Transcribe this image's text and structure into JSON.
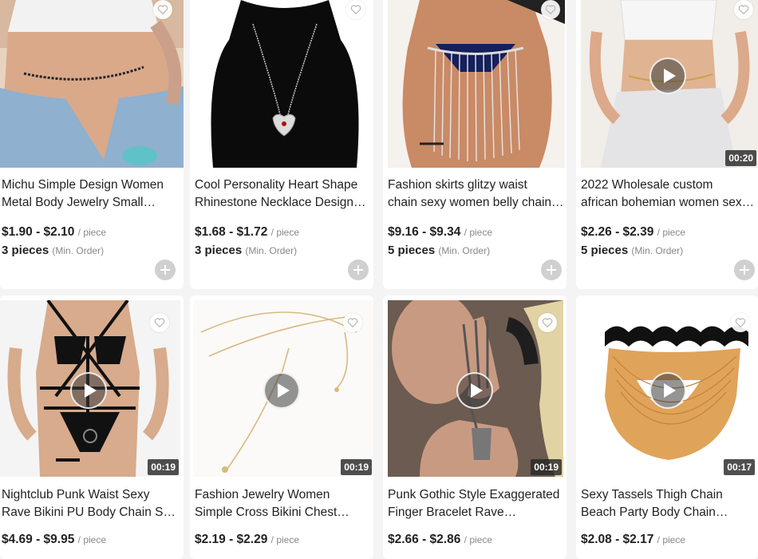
{
  "colors": {
    "background": "#f4f4f4",
    "card": "#ffffff",
    "text": "#222222",
    "muted": "#888888"
  },
  "products": [
    {
      "title_line1": "Michu Simple Design Women",
      "title_line2": "Metal Body Jewelry Small…",
      "price": "$1.90 - $2.10",
      "price_unit": "/ piece",
      "moq": "3 pieces",
      "moq_note": "(Min. Order)",
      "video_duration": null,
      "favorite_icon": "heart-outline-icon",
      "image": "model with black beaded waist chain and ripped jeans"
    },
    {
      "title_line1": "Cool Personality Heart Shape",
      "title_line2": "Rhinestone Necklace Design…",
      "price": "$1.68 - $1.72",
      "price_unit": "/ piece",
      "moq": "3 pieces",
      "moq_note": "(Min. Order)",
      "video_duration": null,
      "favorite_icon": "heart-outline-icon",
      "image": "heart pendant necklace on black bust"
    },
    {
      "title_line1": "Fashion skirts glitzy waist",
      "title_line2": "chain sexy women belly chain…",
      "price": "$9.16 - $9.34",
      "price_unit": "/ piece",
      "moq": "5 pieces",
      "moq_note": "(Min. Order)",
      "video_duration": null,
      "favorite_icon": "heart-outline-icon",
      "image": "rhinestone fringe skirt chain"
    },
    {
      "title_line1": "2022 Wholesale custom",
      "title_line2": "african bohemian women sex…",
      "price": "$2.26 - $2.39",
      "price_unit": "/ piece",
      "moq": "5 pieces",
      "moq_note": "(Min. Order)",
      "video_duration": "00:20",
      "favorite_icon": "heart-outline-icon",
      "image": "model with white top and waist chain"
    },
    {
      "title_line1": "Nightclub Punk Waist Sexy",
      "title_line2": "Rave Bikini PU Body Chain Se…",
      "price": "$4.69 - $9.95",
      "price_unit": "/ piece",
      "video_duration": "00:19",
      "favorite_icon": "heart-outline-icon",
      "image": "black leather harness body chain"
    },
    {
      "title_line1": "Fashion Jewelry Women",
      "title_line2": "Simple Cross Bikini Chest…",
      "price": "$2.19 - $2.29",
      "price_unit": "/ piece",
      "video_duration": "00:19",
      "favorite_icon": "heart-outline-icon",
      "image": "gold cross body chain"
    },
    {
      "title_line1": "Punk Gothic Style Exaggerated",
      "title_line2": "Finger Bracelet Rave…",
      "price": "$2.66 - $2.86",
      "price_unit": "/ piece",
      "video_duration": "00:19",
      "favorite_icon": "heart-outline-icon",
      "image": "hand with metal finger bracelet"
    },
    {
      "title_line1": "Sexy Tassels Thigh Chain",
      "title_line2": "Beach Party Body Chain…",
      "price": "$2.08 - $2.17",
      "price_unit": "/ piece",
      "video_duration": "00:17",
      "favorite_icon": "heart-outline-icon",
      "image": "gold tassel thigh chain"
    }
  ]
}
